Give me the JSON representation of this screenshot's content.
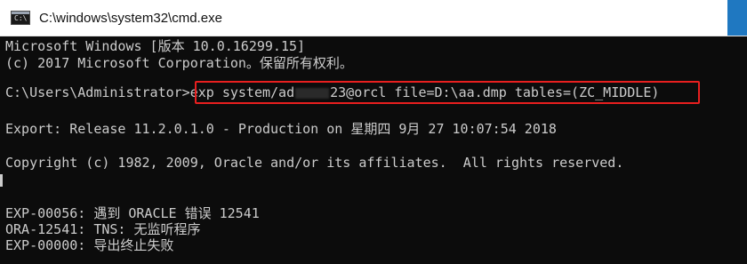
{
  "window": {
    "title": "C:\\windows\\system32\\cmd.exe",
    "icon": "cmd-console-icon",
    "icon_glyph": "C:\\",
    "accent_color": "#1f78c1",
    "background_color": "#0c0c0c",
    "text_color": "#cccccc",
    "highlight_color": "#e81f1f"
  },
  "console": {
    "banner_line1": "Microsoft Windows [版本 10.0.16299.15]",
    "banner_line2": "(c) 2017 Microsoft Corporation。保留所有权利。",
    "prompt": "C:\\Users\\Administrator>",
    "command_prefix": "exp system/ad",
    "command_suffix": "23@orcl file=D:\\aa.dmp tables=(ZC_MIDDLE)",
    "export_line": "Export: Release 11.2.0.1.0 - Production on 星期四 9月 27 10:07:54 2018",
    "copyright_line": "Copyright (c) 1982, 2009, Oracle and/or its affiliates.  All rights reserved.",
    "errors": [
      "EXP-00056: 遇到 ORACLE 错误 12541",
      "ORA-12541: TNS: 无监听程序",
      "EXP-00000: 导出终止失败"
    ]
  }
}
